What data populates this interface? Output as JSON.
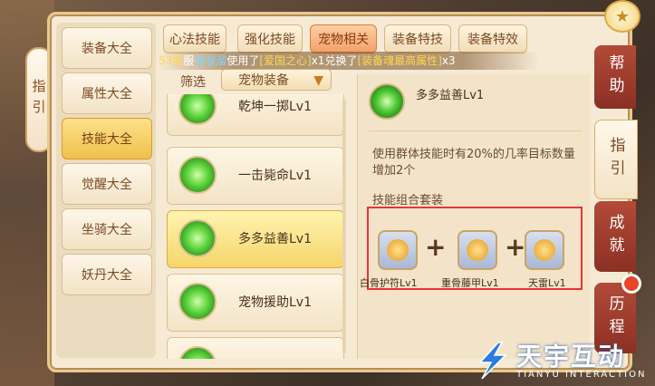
{
  "guide_tab": {
    "label": "指引"
  },
  "categories": [
    {
      "label": "装备大全"
    },
    {
      "label": "属性大全"
    },
    {
      "label": "技能大全",
      "active": true
    },
    {
      "label": "觉醒大全"
    },
    {
      "label": "坐骑大全"
    },
    {
      "label": "妖丹大全"
    }
  ],
  "tabs": [
    {
      "label": "心法技能"
    },
    {
      "label": "强化技能"
    },
    {
      "label": "宠物相关",
      "active": true
    },
    {
      "label": "装备特技"
    },
    {
      "label": "装备特效"
    }
  ],
  "marquee": {
    "server": "53服",
    "mid1": "服",
    "player": "溜溜溜",
    "text1": "使用了",
    "item1": "[爱国之心]",
    "text2": "x1兑换了",
    "item2": "[装备魂最高属性]",
    "text3": "x3"
  },
  "filter": {
    "label": "筛选",
    "value": "宠物装备"
  },
  "skills": [
    {
      "name": "乾坤一掷Lv1"
    },
    {
      "name": "一击毙命Lv1"
    },
    {
      "name": "多多益善Lv1",
      "active": true
    },
    {
      "name": "宠物援助Lv1"
    },
    {
      "name": ""
    }
  ],
  "detail": {
    "title": "多多益善Lv1",
    "description": "使用群体技能时有20%的几率目标数量增加2个",
    "combo_title": "技能组合套装",
    "items": [
      {
        "name": "白骨护符Lv1"
      },
      {
        "name": "重骨藤甲Lv1"
      },
      {
        "name": "天雷Lv1"
      }
    ]
  },
  "right_tabs": [
    {
      "label": "帮助"
    },
    {
      "label": "指引",
      "active": true
    },
    {
      "label": "成就"
    },
    {
      "label": "历程"
    }
  ],
  "logo": {
    "cn": "天宇互动",
    "en": "TIANYU INTERACTION"
  },
  "colors": {
    "accent": "#f2c04c",
    "active_tab": "#f2a06a",
    "highlight_box": "#ee3333",
    "right_tab": "#8b3024"
  }
}
